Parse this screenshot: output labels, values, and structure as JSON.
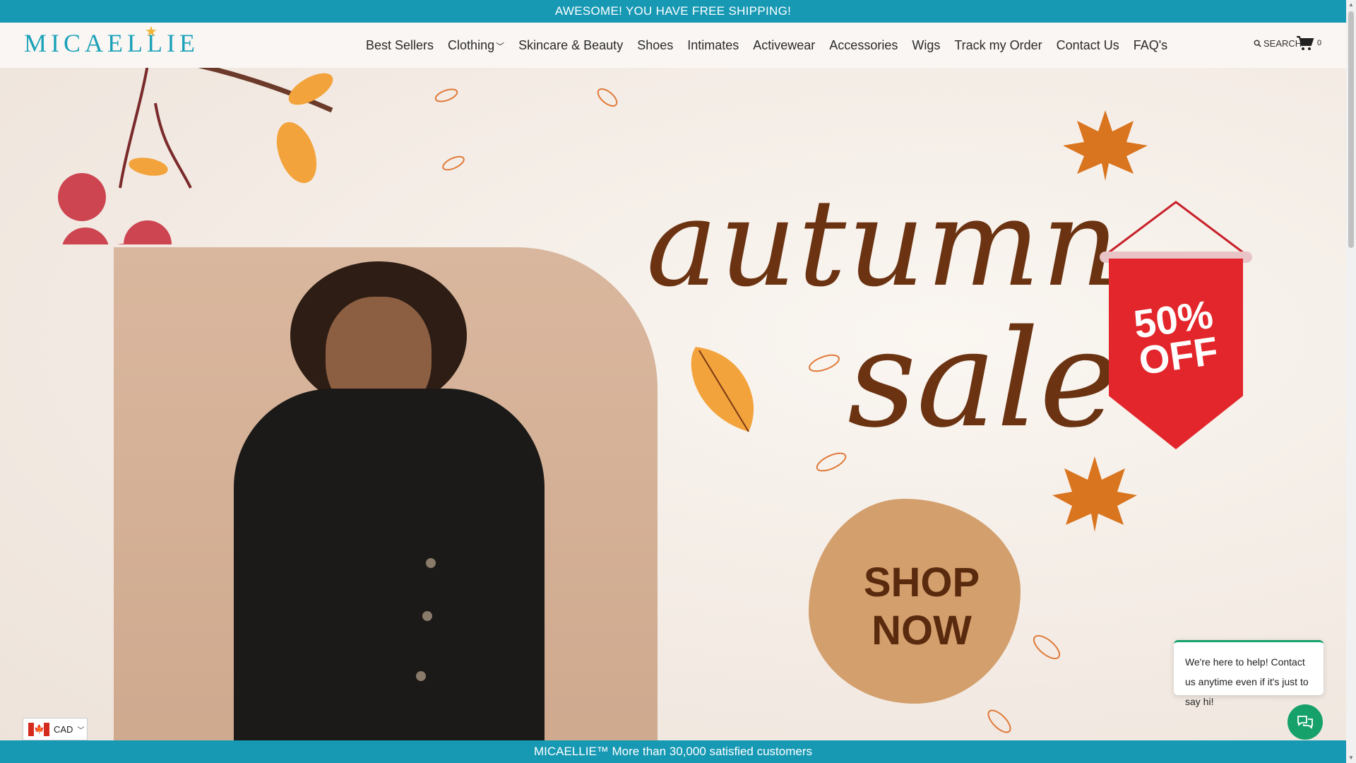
{
  "announcement": "AWESOME! YOU HAVE FREE SHIPPING!",
  "brand": {
    "name": "MICAELLIE"
  },
  "nav": {
    "items": [
      "Best Sellers",
      "Clothing",
      "Skincare & Beauty",
      "Shoes",
      "Intimates",
      "Activewear",
      "Accessories",
      "Wigs",
      "Track my Order",
      "Contact Us",
      "FAQ's"
    ]
  },
  "search": {
    "label": "SEARCH"
  },
  "cart": {
    "count": "0"
  },
  "hero": {
    "title_line1": "autumn",
    "title_line2": "sale",
    "badge_line1": "50%",
    "badge_line2": "OFF",
    "cta_line1": "SHOP",
    "cta_line2": "NOW"
  },
  "chat": {
    "message": "We're here to help! Contact us anytime even if it's just to say hi!"
  },
  "currency": {
    "code": "CAD"
  },
  "footer_bar": "MICAELLIE™ More than 30,000 satisfied customers",
  "colors": {
    "teal": "#1799b4",
    "brown": "#6b3312",
    "red": "#e2262b",
    "green": "#16a16b"
  }
}
